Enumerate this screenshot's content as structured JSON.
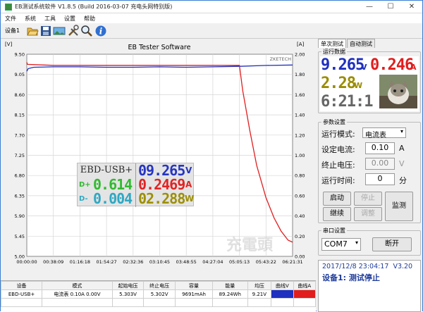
{
  "window": {
    "title": "EB测试系统软件 V1.8.5 (Build 2016-03-07 充电头网特别版)",
    "controls": [
      "minimize",
      "maximize",
      "close"
    ]
  },
  "menu": [
    "文件",
    "系统",
    "工具",
    "设置",
    "帮助"
  ],
  "toolbar": {
    "device_label": "设备1",
    "icons": [
      "folder-open-icon",
      "save-icon",
      "image-icon",
      "tools-icon",
      "search-icon",
      "info-icon"
    ]
  },
  "chart_data": {
    "type": "line",
    "title": "EB Tester Software",
    "watermark": "ZKETECH",
    "left_unit": "[V]",
    "right_unit": "[A]",
    "ylim_left": [
      5.0,
      9.5
    ],
    "ylim_right": [
      0.0,
      2.0
    ],
    "y_ticks_left": [
      "9.50",
      "9.05",
      "8.60",
      "8.15",
      "7.70",
      "7.25",
      "6.80",
      "6.35",
      "5.90",
      "5.45",
      "5.00"
    ],
    "y_ticks_right": [
      "2.00",
      "1.80",
      "1.60",
      "1.40",
      "1.20",
      "1.00",
      "0.80",
      "0.60",
      "0.40",
      "0.20",
      "0.00"
    ],
    "x_ticks": [
      "00:00:00",
      "00:38:09",
      "01:16:18",
      "01:54:27",
      "02:32:36",
      "03:10:45",
      "03:48:55",
      "04:27:04",
      "05:05:13",
      "05:43:22",
      "06:21:31"
    ],
    "grid": true,
    "series": [
      {
        "name": "曲线V",
        "color": "#1f2fbf",
        "axis": "left",
        "x": [
          "00:00:00",
          "00:02:00",
          "00:10:00",
          "00:38:09",
          "01:16:18",
          "01:54:27",
          "02:32:36",
          "03:10:45",
          "03:48:55",
          "04:27:04",
          "05:05:13",
          "05:43:22",
          "06:21:31"
        ],
        "values": [
          9.12,
          9.18,
          9.21,
          9.22,
          9.22,
          9.21,
          9.21,
          9.22,
          9.21,
          9.22,
          9.23,
          9.25,
          9.26
        ]
      },
      {
        "name": "曲线A",
        "color": "#e11d1d",
        "axis": "right",
        "x": [
          "00:00:00",
          "00:01:00",
          "00:38:09",
          "01:16:18",
          "01:54:27",
          "02:32:36",
          "03:10:45",
          "03:48:55",
          "04:27:04",
          "05:05:13",
          "05:10:00",
          "05:20:00",
          "05:30:00",
          "05:43:22",
          "05:55:00",
          "06:05:00",
          "06:15:00",
          "06:21:31"
        ],
        "values": [
          1.92,
          1.9,
          1.89,
          1.89,
          1.89,
          1.89,
          1.89,
          1.89,
          1.89,
          1.89,
          1.64,
          1.25,
          0.9,
          0.58,
          0.38,
          0.25,
          0.16,
          0.14
        ]
      }
    ]
  },
  "overlay": {
    "model": "EBD-USB+",
    "voltage": "09.265",
    "voltage_unit": "V",
    "dp_label": "D+",
    "dp_value": "0.614",
    "current": "0.2469",
    "current_unit": "A",
    "dm_label": "D-",
    "dm_value": "0.004",
    "power": "02.288",
    "power_unit": "W"
  },
  "right_panel": {
    "tabs": [
      "单次测试",
      "自动测试"
    ],
    "live_group_label": "运行数据",
    "voltage": "9.265",
    "voltage_unit": "V",
    "current": "0.246",
    "current_unit": "A",
    "power": "2.28",
    "power_unit": "W",
    "time": "6:21:1",
    "params_group_label": "参数设置",
    "mode_label": "运行模式:",
    "mode_value": "电流表",
    "set_current_label": "设定电流:",
    "set_current_value": "0.10",
    "set_current_unit": "A",
    "end_voltage_label": "终止电压:",
    "end_voltage_value": "0.00",
    "end_voltage_unit": "V",
    "run_time_label": "运行时间:",
    "run_time_value": "0",
    "run_time_unit": "分",
    "buttons": {
      "start": "启动",
      "stop": "停止",
      "monitor": "监测",
      "continue": "继续",
      "adjust": "调整"
    },
    "serial_group_label": "串口设置",
    "port": "COM7",
    "open_button": "断开"
  },
  "status": {
    "datetime": "2017/12/8 23:04:17",
    "version": "V3.20",
    "state": "设备1: 测试停止"
  },
  "table": {
    "headers": [
      "设备",
      "模式",
      "起始电压",
      "终止电压",
      "容量",
      "能量",
      "均压",
      "曲线V",
      "曲线A"
    ],
    "rows": [
      [
        "EBD-USB+",
        "电流表 0.10A 0.00V",
        "5.303V",
        "5.302V",
        "9691mAh",
        "89.24Wh",
        "9.21V",
        "",
        ""
      ]
    ]
  },
  "colors": {
    "voltage_blue": "#1f2fbf",
    "current_red": "#e11d1d",
    "power_olive": "#9a8c00",
    "time_gray": "#666666",
    "overlay_green": "#2bb82b",
    "overlay_cyan": "#2aa6c2"
  }
}
